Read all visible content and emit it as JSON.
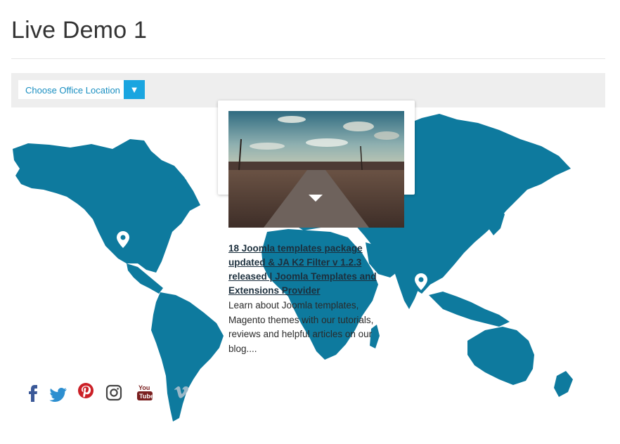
{
  "page": {
    "title": "Live Demo 1"
  },
  "location_select": {
    "label": "Choose Office Location",
    "arrow": "▼"
  },
  "colors": {
    "map": "#0e7a9e",
    "accent": "#1aa5e0"
  },
  "markers": [
    {
      "name": "north-america"
    },
    {
      "name": "asia"
    }
  ],
  "popup": {
    "title": "18 Joomla templates package updated & JA K2 Filter v 1.2.3 released | Joomla Templates and Extensions Provider",
    "description": "Learn about Joomla templates, Magento themes with our tutorials, reviews and helpful articles on our blog...."
  },
  "social": [
    {
      "name": "facebook",
      "color": "#3b5998"
    },
    {
      "name": "twitter",
      "color": "#2d8fd0"
    },
    {
      "name": "pinterest",
      "color": "#cb2027"
    },
    {
      "name": "instagram",
      "color": "#444444"
    },
    {
      "name": "youtube",
      "color": "#7a1f1f"
    },
    {
      "name": "vimeo",
      "color": "#9ab8c8"
    }
  ]
}
